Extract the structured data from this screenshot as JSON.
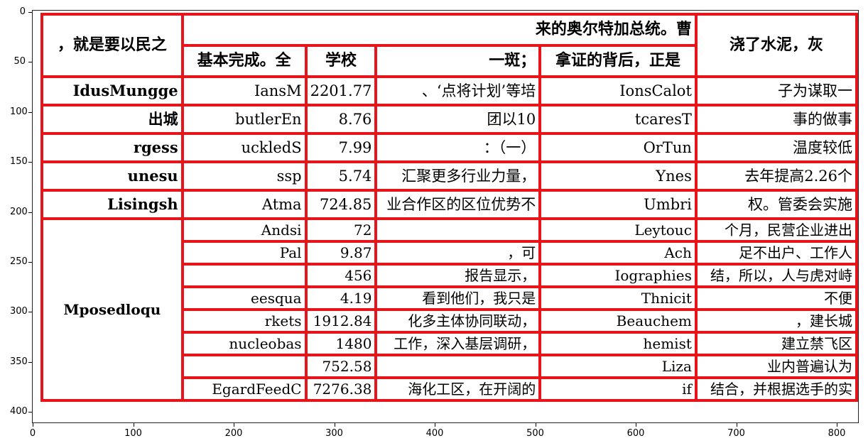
{
  "table": {
    "header_top": {
      "c0": "，就是要以民之",
      "group": "来的奥尔特加总统。曹",
      "c6": "浇了水泥，灰"
    },
    "header_sub": [
      "基本完成。全",
      "学校",
      "一斑；",
      "拿证的背后，正是"
    ],
    "rows": [
      [
        "IdusMungge",
        "IansM",
        "2201.77",
        "、‘点将计划’等培",
        "IonsCalot",
        "子为谋取一"
      ],
      [
        "出城",
        "butlerEn",
        "8.76",
        "团以10",
        "tcaresT",
        "事的做事"
      ],
      [
        "rgess",
        "uckledS",
        "7.99",
        "：（一）",
        "OrTun",
        "温度较低"
      ],
      [
        "unesu",
        "ssp",
        "5.74",
        "汇聚更多行业力量，",
        "Ynes",
        "去年提高2.26个"
      ],
      [
        "Lisingsh",
        "Atma",
        "724.85",
        "业合作区的区位优势不",
        "Umbri",
        "权。管委会实施"
      ]
    ],
    "group_label": "Mposedloqu",
    "group_rows": [
      [
        "Andsi",
        "72",
        "",
        "Leytouc",
        "个月，民营企业进出"
      ],
      [
        "Pal",
        "9.87",
        "，可",
        "Ach",
        "足不出户、工作人"
      ],
      [
        "",
        "456",
        "报告显示，",
        "Iographies",
        "结，所以，人与虎对峙"
      ],
      [
        "eesqua",
        "4.19",
        "看到他们，我只是",
        "Thnicit",
        "不便"
      ],
      [
        "rkets",
        "1912.84",
        "化多主体协同联动，",
        "Beauchem",
        "，建长城"
      ],
      [
        "nucleobas",
        "1480",
        "工作，深入基层调研，",
        "hemist",
        "建立禁飞区"
      ],
      [
        "",
        "752.58",
        "",
        "Liza",
        "业内普遍认为"
      ],
      [
        "EgardFeedC",
        "7276.38",
        "海化工区，在开阔的",
        "if",
        "结合，并根据选手的实"
      ]
    ]
  },
  "axes": {
    "yticks": [
      "0",
      "50",
      "100",
      "150",
      "200",
      "250",
      "300",
      "350",
      "400"
    ],
    "xticks": [
      "0",
      "100",
      "200",
      "300",
      "400",
      "500",
      "600",
      "700",
      "800"
    ]
  }
}
